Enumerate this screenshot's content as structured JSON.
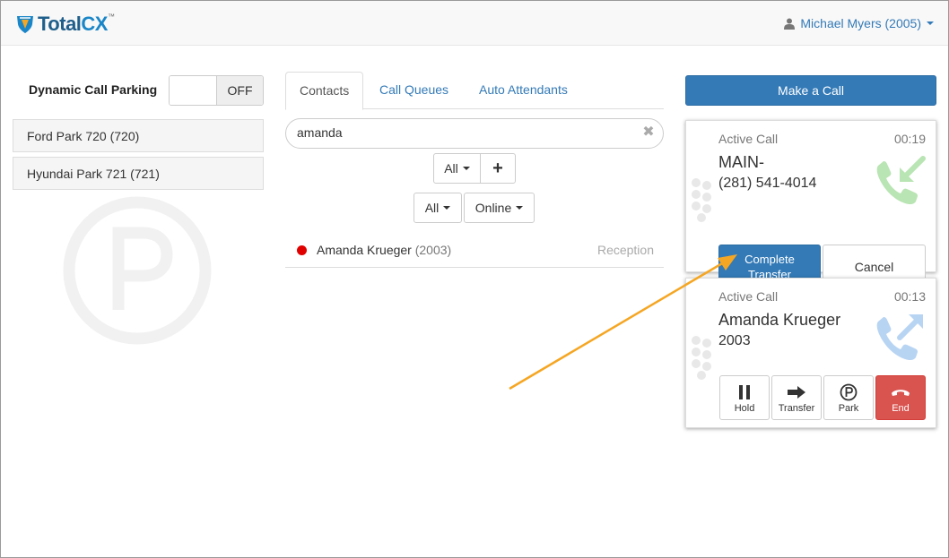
{
  "header": {
    "logo_text_a": "Total",
    "logo_text_b": "CX",
    "logo_tm": "™",
    "user_label": "Michael Myers (2005)",
    "user_icon": "user-icon"
  },
  "parking": {
    "title": "Dynamic Call Parking",
    "toggle_state": "OFF",
    "lots": [
      {
        "label": "Ford Park 720 (720)"
      },
      {
        "label": "Hyundai Park 721 (721)"
      }
    ],
    "watermark_icon": "parking-icon"
  },
  "directory": {
    "tabs": [
      {
        "label": "Contacts",
        "active": true
      },
      {
        "label": "Call Queues",
        "active": false
      },
      {
        "label": "Auto Attendants",
        "active": false
      }
    ],
    "search": {
      "value": "amanda",
      "placeholder": ""
    },
    "filter_type": "All",
    "filter_scope": "All",
    "filter_status": "Online",
    "add_label": "+",
    "contacts": [
      {
        "name": "Amanda Krueger",
        "ext": "(2003)",
        "dept": "Reception",
        "status_color": "#e00000"
      }
    ]
  },
  "calls": {
    "make_call_label": "Make a Call",
    "active": [
      {
        "label": "Active Call",
        "timer": "00:19",
        "name": "MAIN-",
        "number": "(281) 541-4014",
        "icon": "incoming-call-icon",
        "complete_label_1": "Complete",
        "complete_label_2": "Transfer",
        "cancel_label": "Cancel"
      },
      {
        "label": "Active Call",
        "timer": "00:13",
        "name": "Amanda Krueger",
        "number": "2003",
        "icon": "transfer-call-icon",
        "actions": {
          "hold": "Hold",
          "transfer": "Transfer",
          "park": "Park",
          "end": "End"
        }
      }
    ]
  },
  "colors": {
    "primary": "#337ab7",
    "danger": "#d9534f",
    "status_busy": "#e00000",
    "annotation_arrow": "#f5a623",
    "incoming_icon": "#b9e4b3",
    "transfer_icon": "#b8d4f3"
  }
}
